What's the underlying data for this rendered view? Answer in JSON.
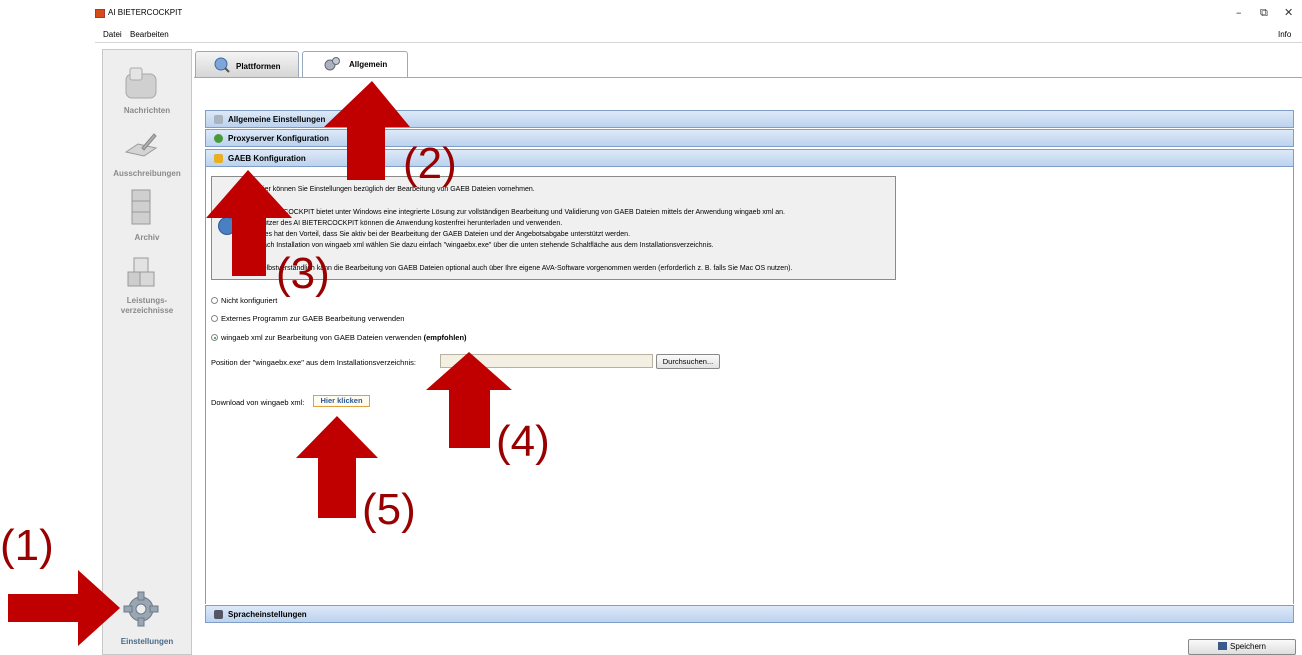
{
  "window": {
    "title": "AI BIETERCOCKPIT",
    "minimize_glyph": "–",
    "restore_glyph": "⧉",
    "close_glyph": "✕"
  },
  "menu": {
    "items": [
      "Datei",
      "Bearbeiten"
    ],
    "right": "Info"
  },
  "sidebar": {
    "items": [
      {
        "label": "Nachrichten",
        "icon": "mailbox-icon"
      },
      {
        "label": "Ausschreibungen",
        "icon": "pen-icon"
      },
      {
        "label": "Archiv",
        "icon": "archive-cabinet-icon"
      },
      {
        "label_line1": "Leistungs-",
        "label_line2": "verzeichnisse",
        "icon": "cubes-icon"
      },
      {
        "label": "Einstellungen",
        "icon": "gear-icon"
      }
    ]
  },
  "tabs": [
    {
      "label": "Plattformen",
      "icon": "globe-search-icon",
      "active": false
    },
    {
      "label": "Allgemein",
      "icon": "gears-icon",
      "active": true
    }
  ],
  "accordion": {
    "general": "Allgemeine Einstellungen",
    "proxy": "Proxyserver Konfiguration",
    "gaeb": "GAEB Konfiguration",
    "language": "Spracheinstellungen"
  },
  "info": {
    "line1": "Hier können Sie Einstellungen bezüglich der Bearbeitung von GAEB Dateien vornehmen.",
    "line2": "BIETERCOCKPIT bietet unter Windows eine integrierte Lösung zur vollständigen Bearbeitung und Validierung von GAEB Dateien mittels der Anwendung wingaeb xml an.",
    "line3": "Nutzer des AI BIETERCOCKPIT können die Anwendung kostenfrei herunterladen und verwenden.",
    "line4": "Dies hat den Vorteil, dass Sie aktiv bei der Bearbeitung der GAEB Dateien und der Angebotsabgabe unterstützt werden.",
    "line5": "Nach Installation von wingaeb xml wählen Sie dazu einfach \"wingaebx.exe\" über die unten stehende Schaltfläche aus dem Installationsverzeichnis.",
    "line6": "Selbstverständlich kann die Bearbeitung von GAEB Dateien optional auch über Ihre eigene AVA-Software vorgenommen werden (erforderlich z. B. falls Sie Mac OS nutzen)."
  },
  "options": {
    "not_configured": "Nicht konfiguriert",
    "external": "Externes Programm zur GAEB Bearbeitung verwenden",
    "wingaeb": "wingaeb xml zur Bearbeitung von GAEB Dateien verwenden",
    "recommended": "(empfohlen)",
    "selected": "wingaeb"
  },
  "path": {
    "label": "Position der \"wingaebx.exe\" aus dem Installationsverzeichnis:",
    "value": "",
    "browse": "Durchsuchen..."
  },
  "download": {
    "label": "Download von wingaeb xml:",
    "link": "Hier klicken"
  },
  "save": {
    "label": "Speichern"
  },
  "annotations": [
    "(1)",
    "(2)",
    "(3)",
    "(4)",
    "(5)"
  ],
  "colors": {
    "arrow": "#c00000",
    "accordion": "#bcd2ee"
  }
}
